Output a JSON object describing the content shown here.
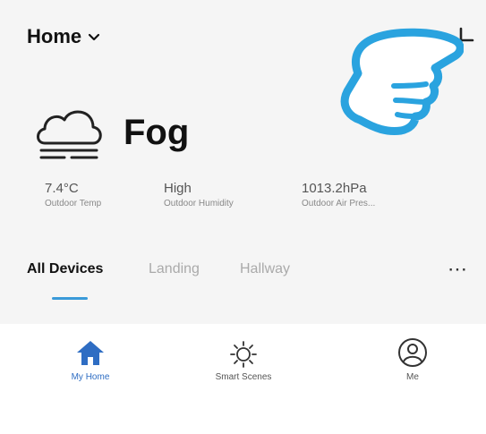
{
  "header": {
    "home_label": "Home"
  },
  "weather": {
    "condition": "Fog"
  },
  "stats": [
    {
      "value": "7.4°C",
      "label": "Outdoor Temp"
    },
    {
      "value": "High",
      "label": "Outdoor Humidity"
    },
    {
      "value": "1013.2hPa",
      "label": "Outdoor Air Pres..."
    }
  ],
  "tabs": [
    {
      "label": "All Devices",
      "active": true
    },
    {
      "label": "Landing",
      "active": false
    },
    {
      "label": "Hallway",
      "active": false
    }
  ],
  "more_label": "⋯",
  "bottom_nav": [
    {
      "label": "My Home",
      "icon": "home-icon",
      "active": true
    },
    {
      "label": "Smart Scenes",
      "icon": "sun-icon",
      "active": false
    },
    {
      "label": "Me",
      "icon": "user-icon",
      "active": false
    }
  ],
  "colors": {
    "accent": "#2e6dc3",
    "tab_underline": "#3a9ad9",
    "hand_outline": "#2aa3df"
  }
}
